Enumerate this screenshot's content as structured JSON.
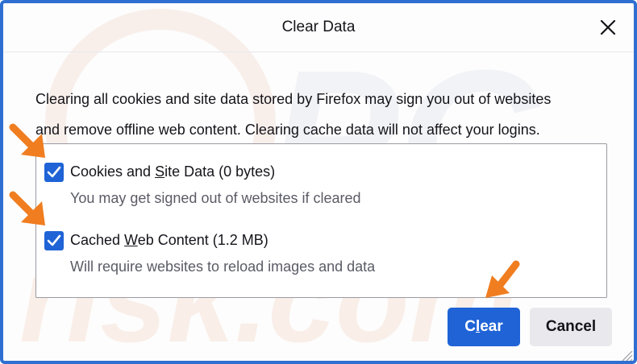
{
  "dialog": {
    "title": "Clear Data",
    "close_icon": "close-icon",
    "description_line1": "Clearing all cookies and site data stored by Firefox may sign you out of websites",
    "description_line2": "and remove offline web content. Clearing cache data will not affect your logins."
  },
  "options": [
    {
      "checked": true,
      "label_pre": "Cookies and ",
      "label_key": "S",
      "label_post": "ite Data (0 bytes)",
      "sublabel": "You may get signed out of websites if cleared"
    },
    {
      "checked": true,
      "label_pre": "Cached ",
      "label_key": "W",
      "label_post": "eb Content (1.2 MB)",
      "sublabel": "Will require websites to reload images and data"
    }
  ],
  "buttons": {
    "clear_pre": "C",
    "clear_key": "l",
    "clear_post": "ear",
    "cancel": "Cancel"
  },
  "watermark": {
    "text_top": "PC",
    "text_bottom": "risk.com"
  },
  "colors": {
    "border": "#2f6fd1",
    "accent": "#1f63d6",
    "arrow": "#f07d1f",
    "secondary_button": "#e9e9ed"
  }
}
